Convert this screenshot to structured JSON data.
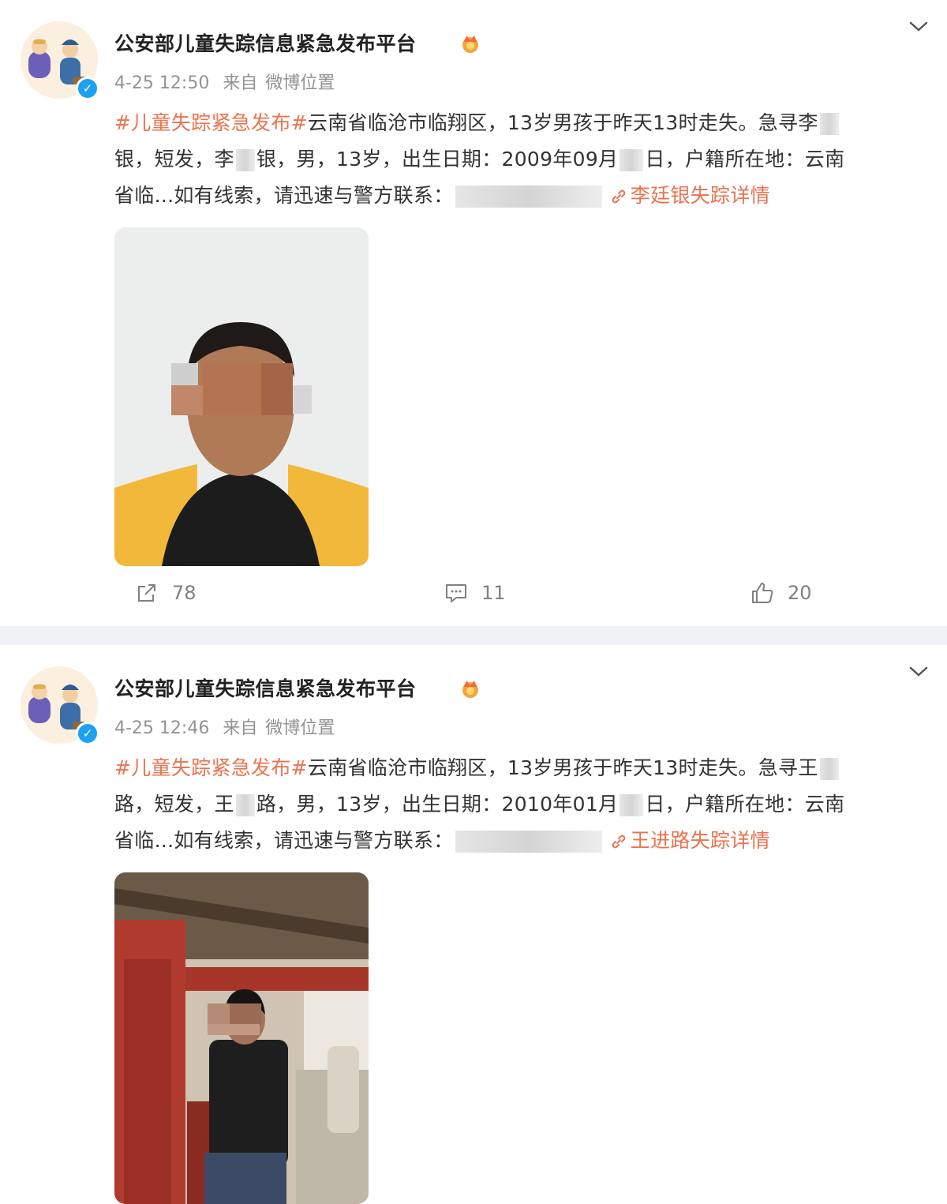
{
  "posts": [
    {
      "username": "公安部儿童失踪信息紧急发布平台",
      "time": "4-25 12:50",
      "source": "来自",
      "location": "微博位置",
      "lines": {
        "hashtag": "#儿童失踪紧急发布#",
        "l1_text": "云南省临沧市临翔区，13岁男孩于昨天13时走失。急寻李",
        "l2_a": "银，短发，李",
        "l2_b": "银，男，13岁，出生日期：2009年09月",
        "l2_c": "日，户籍所在地：云南",
        "l3_text": "省临...如有线索，请迅速与警方联系：",
        "link_text": "李廷银失踪详情"
      },
      "stats": {
        "repost": "78",
        "comment": "11",
        "like": "20"
      }
    },
    {
      "username": "公安部儿童失踪信息紧急发布平台",
      "time": "4-25 12:46",
      "source": "来自",
      "location": "微博位置",
      "lines": {
        "hashtag": "#儿童失踪紧急发布#",
        "l1_text": "云南省临沧市临翔区，13岁男孩于昨天13时走失。急寻王",
        "l2_a": "路，短发，王",
        "l2_b": "路，男，13岁，出生日期：2010年01月",
        "l2_c": "日，户籍所在地：云南",
        "l3_text": "省临...如有线索，请迅速与警方联系：",
        "link_text": "王进路失踪详情"
      }
    }
  ],
  "icons": {
    "expand": "chevron-down-icon",
    "badge": "crown-icon",
    "verified": "verified-icon",
    "repost": "share-icon",
    "comment": "comment-icon",
    "like": "thumbs-up-icon",
    "link": "link-icon"
  },
  "colors": {
    "accent": "#eb7350",
    "muted": "#939393",
    "separator": "#f1f2f5"
  }
}
